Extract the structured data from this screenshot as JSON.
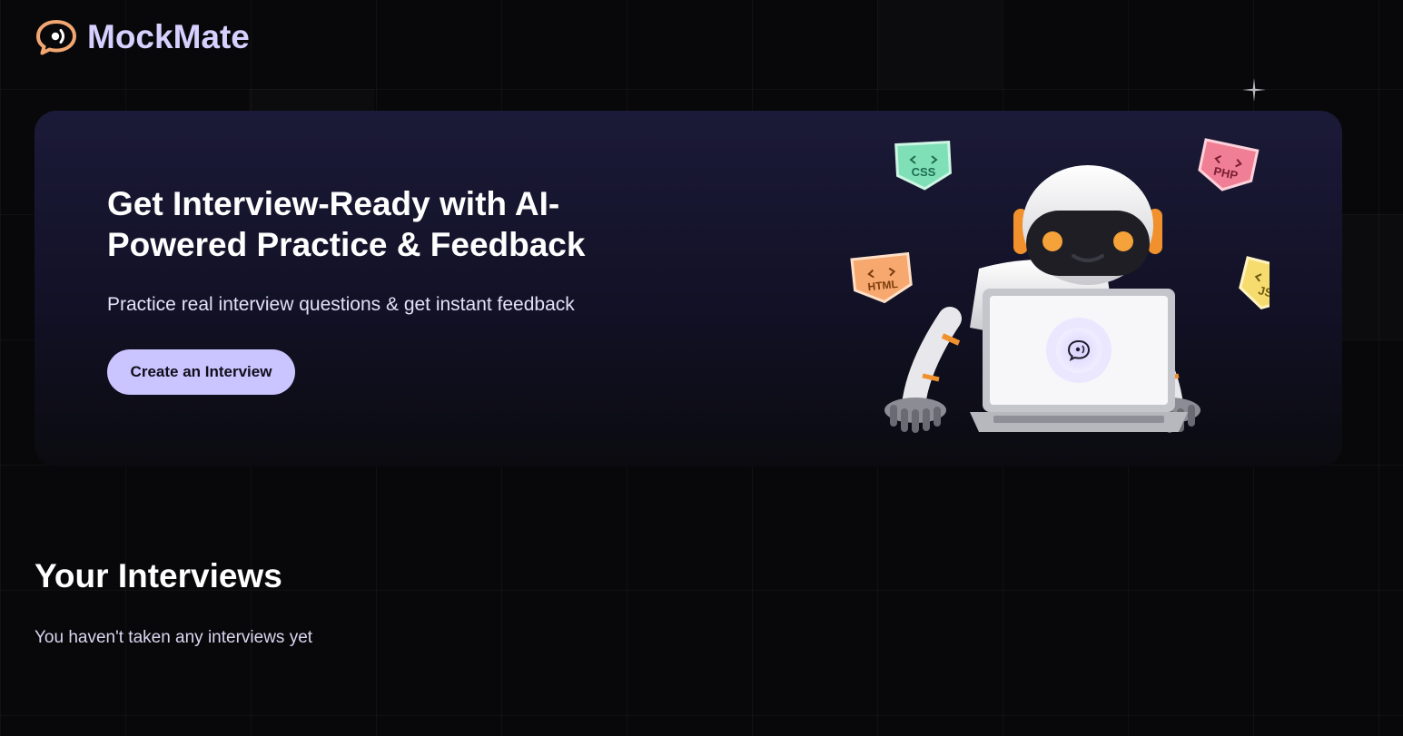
{
  "brand": {
    "name": "MockMate",
    "logo_icon": "chat-bubble-icon",
    "accent_color": "#cac4ff",
    "logo_color": "#f2a772"
  },
  "hero": {
    "title": "Get Interview-Ready with AI-Powered Practice & Feedback",
    "subtitle": "Practice real interview questions & get instant feedback",
    "cta_label": "Create an Interview",
    "badges": [
      {
        "label": "CSS",
        "icon": "code-icon",
        "color": "#7fe0b8"
      },
      {
        "label": "PHP",
        "icon": "code-icon",
        "color": "#f07f95"
      },
      {
        "label": "HTML",
        "icon": "code-icon",
        "color": "#f6a86f"
      },
      {
        "label": "JS",
        "icon": "code-icon",
        "color": "#f6dc6f"
      }
    ]
  },
  "interviews": {
    "title": "Your Interviews",
    "empty_message": "You haven't taken any interviews yet"
  }
}
